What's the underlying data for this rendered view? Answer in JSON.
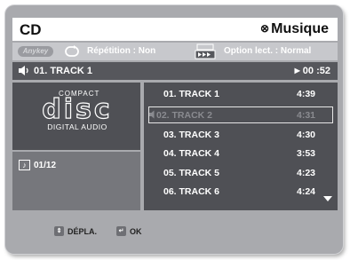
{
  "header": {
    "title": "CD",
    "mode_label": "Musique",
    "mode_icon": "disc-symbol-icon"
  },
  "options_bar": {
    "anykey_label": "Anykey",
    "repeat_text": "Répétition : Non",
    "play_option_text": "Option lect. : Normal"
  },
  "now_playing": {
    "track": "01. TRACK 1",
    "time": "00 :52"
  },
  "disc_logo": {
    "compact": "COMPACT",
    "disc": "disc",
    "digital_audio": "DIGITAL AUDIO"
  },
  "track_counter": "01/12",
  "tracks": [
    {
      "name": "01. TRACK 1",
      "time": "4:39"
    },
    {
      "name": "02. TRACK 2",
      "time": "4:31"
    },
    {
      "name": "03. TRACK 3",
      "time": "4:30"
    },
    {
      "name": "04. TRACK 4",
      "time": "3:53"
    },
    {
      "name": "05. TRACK 5",
      "time": "4:23"
    },
    {
      "name": "06. TRACK 6",
      "time": "4:24"
    }
  ],
  "footer": {
    "move_label": "DÉPLA.",
    "ok_label": "OK"
  },
  "colors": {
    "frame": "#a9aaae",
    "panel_dark": "#4f5055",
    "now_bar": "#56575c"
  }
}
